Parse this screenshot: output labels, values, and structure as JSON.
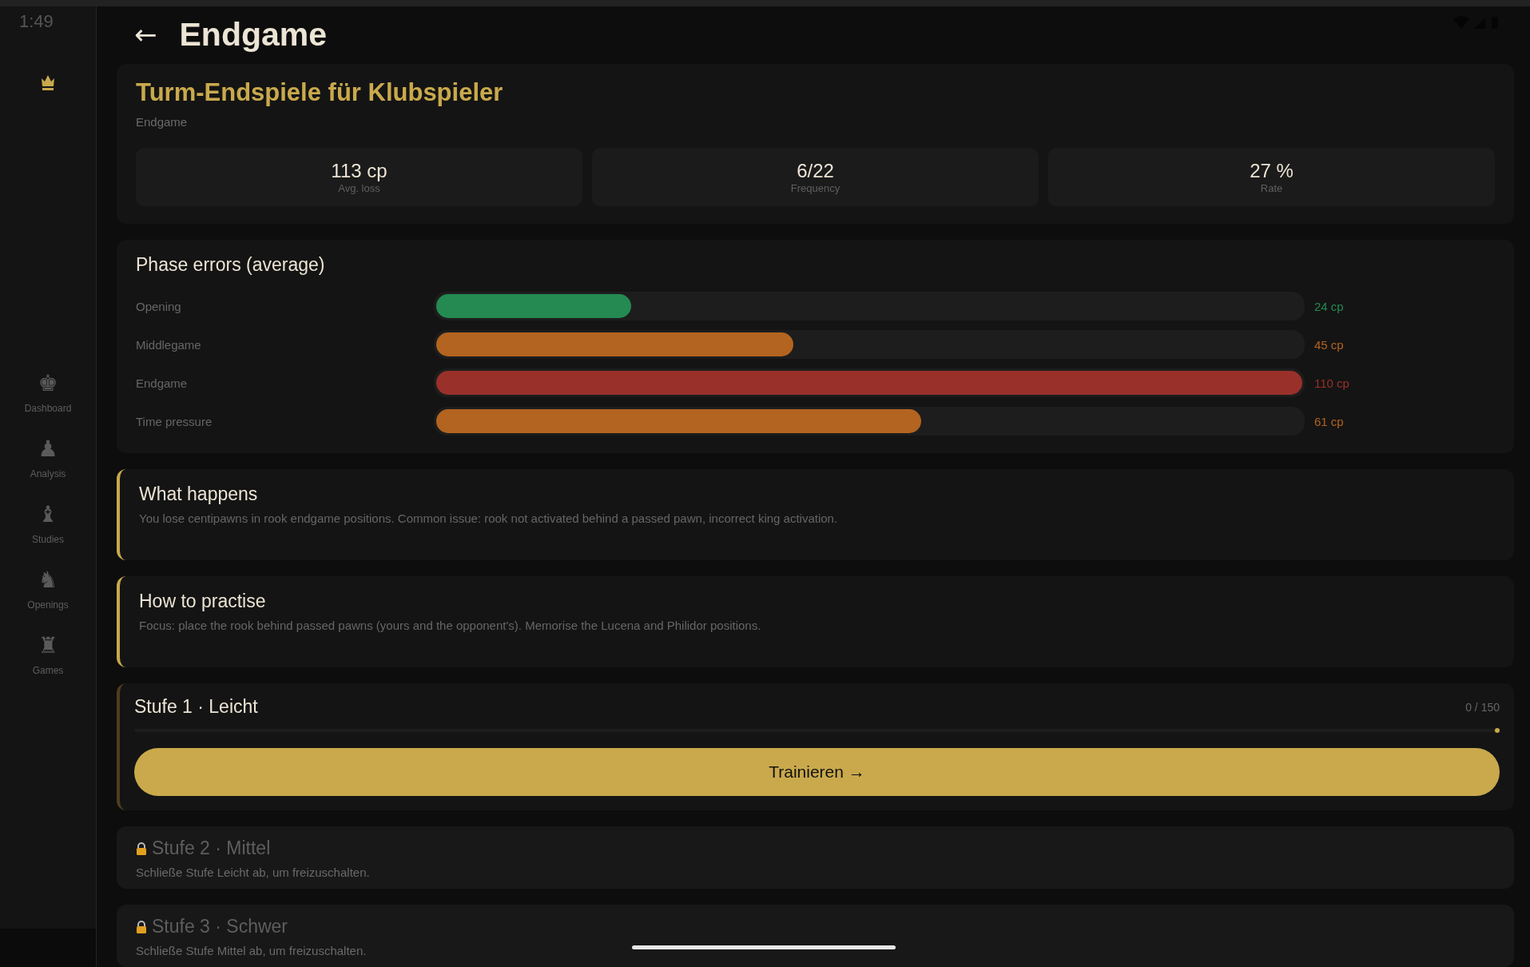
{
  "status_bar": {
    "time": "1:49"
  },
  "sidebar": {
    "items": [
      {
        "icon": "♚",
        "label": "Dashboard",
        "selected": false
      },
      {
        "icon": "♟",
        "label": "Analysis",
        "selected": false
      },
      {
        "icon": "♝",
        "label": "Studies",
        "selected": false
      },
      {
        "icon": "♞",
        "label": "Openings",
        "selected": false
      },
      {
        "icon": "♜",
        "label": "Games",
        "selected": false
      }
    ]
  },
  "header": {
    "back": "←",
    "title": "Endgame"
  },
  "summary": {
    "title": "Turm-Endspiele für Klubspieler",
    "category": "Endgame",
    "stats": [
      {
        "value": "113 cp",
        "label": "Avg. loss"
      },
      {
        "value": "6/22",
        "label": "Frequency"
      },
      {
        "value": "27 %",
        "label": "Rate"
      }
    ]
  },
  "phase_errors": {
    "title": "Phase errors (average)",
    "rows": [
      {
        "label": "Opening",
        "level": 0.225,
        "reading": "24 cp",
        "color": "#248a52"
      },
      {
        "label": "Middlegame",
        "level": 0.412,
        "reading": "45 cp",
        "color": "#b36420"
      },
      {
        "label": "Endgame",
        "level": 1.0,
        "reading": "110 cp",
        "color": "#99312a"
      },
      {
        "label": "Time pressure",
        "level": 0.56,
        "reading": "61 cp",
        "color": "#b36420"
      }
    ]
  },
  "notes": [
    {
      "title": "What happens",
      "text": "You lose centipawns in rook endgame positions. Common issue: rook not activated behind a passed pawn, incorrect king activation."
    },
    {
      "title": "How to practise",
      "text": "Focus: place the rook behind passed pawns (yours and the opponent's). Memorise the Lucena and Philidor positions."
    }
  ],
  "levels": [
    {
      "title": "Stufe 1 · Leicht",
      "locked": false,
      "progress": "0 / 150",
      "level": 0,
      "button": "Trainieren →"
    },
    {
      "title": "Stufe 2 · Mittel",
      "locked": true,
      "hint": "Schließe Stufe Leicht ab, um freizuschalten."
    },
    {
      "title": "Stufe 3 · Schwer",
      "locked": true,
      "hint": "Schließe Stufe Mittel ab, um freizuschalten."
    }
  ]
}
